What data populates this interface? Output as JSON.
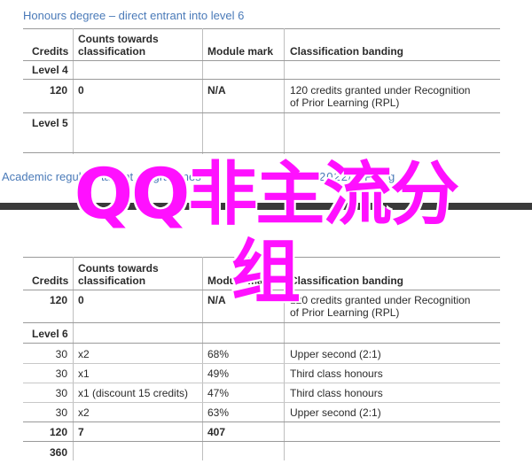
{
  "table1": {
    "title": "Honours degree – direct entrant into level 6",
    "headers": {
      "credits": "Credits",
      "counts": [
        "Counts towards",
        "classification"
      ],
      "module_mark": "Module mark",
      "classification": "Classification banding"
    },
    "level4": "Level 4",
    "row": {
      "credits": "120",
      "counts": "0",
      "module_mark": "N/A",
      "classification": [
        "120 credits granted under Recognition",
        "of Prior Learning (RPL)"
      ]
    },
    "level5": "Level 5"
  },
  "band": {
    "left_text": "Academic regul      for taught programmes",
    "right_text": "2022/     | P a g e"
  },
  "overlay": {
    "line1": "QQ非主流分",
    "line2": "组"
  },
  "table2": {
    "headers": {
      "credits": "Credits",
      "counts": [
        "Counts towards",
        "classification"
      ],
      "module_mark": "Module mark",
      "classification": "Classification banding"
    },
    "row": {
      "credits": "120",
      "counts": "0",
      "module_mark": "N/A",
      "classification": [
        "120 credits granted under Recognition",
        "of Prior Learning (RPL)"
      ]
    },
    "level6": "Level 6",
    "level6_rows": [
      {
        "credits": "30",
        "counts": "x2",
        "mark": "68%",
        "classification": "Upper second (2:1)"
      },
      {
        "credits": "30",
        "counts": "x1",
        "mark": "49%",
        "classification": "Third class honours"
      },
      {
        "credits": "30",
        "counts": "x1 (discount 15 credits)",
        "mark": "47%",
        "classification": "Third class honours"
      },
      {
        "credits": "30",
        "counts": "x2",
        "mark": "63%",
        "classification": "Upper second (2:1)"
      }
    ],
    "total": {
      "credits": "120",
      "counts": "7",
      "mark": "407"
    },
    "grand_total": {
      "credits": "360"
    }
  }
}
